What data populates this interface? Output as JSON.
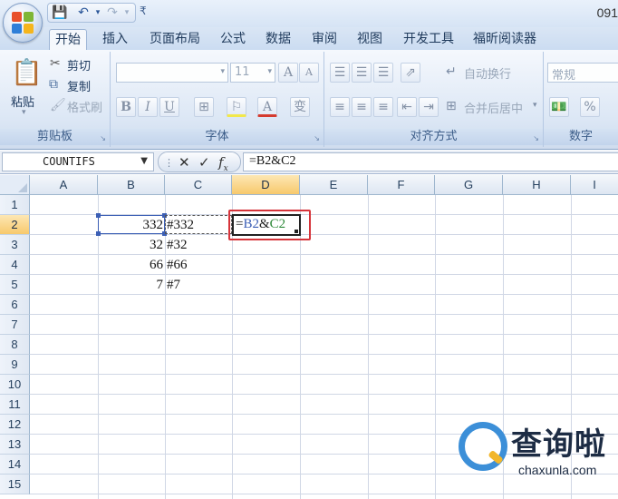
{
  "window": {
    "title_fragment": "091"
  },
  "quick_access": {
    "customize_glyph": "₹"
  },
  "tabs": [
    {
      "label": "开始",
      "active": true
    },
    {
      "label": "插入"
    },
    {
      "label": "页面布局"
    },
    {
      "label": "公式"
    },
    {
      "label": "数据"
    },
    {
      "label": "审阅"
    },
    {
      "label": "视图"
    },
    {
      "label": "开发工具"
    },
    {
      "label": "福昕阅读器"
    }
  ],
  "ribbon": {
    "clipboard": {
      "paste": "粘贴",
      "cut": "剪切",
      "copy": "复制",
      "format_painter": "格式刷",
      "label": "剪贴板"
    },
    "font": {
      "font_name": "",
      "font_size": "11",
      "grow": "A",
      "shrink": "A",
      "bold": "B",
      "italic": "I",
      "underline": "U",
      "font_color": "A",
      "label": "字体"
    },
    "alignment": {
      "wrap_text": "自动换行",
      "merge_center": "合并后居中",
      "label": "对齐方式"
    },
    "number": {
      "format": "常规",
      "percent": "%",
      "label": "数字"
    }
  },
  "formula_bar": {
    "name_box": "COUNTIFS",
    "formula": "=B2&C2"
  },
  "grid": {
    "columns": [
      "A",
      "B",
      "C",
      "D",
      "E",
      "F",
      "G",
      "H",
      "I"
    ],
    "selected_column": "D",
    "rows": [
      "1",
      "2",
      "3",
      "4",
      "5",
      "6",
      "7",
      "8",
      "9",
      "10",
      "11",
      "12",
      "13",
      "14",
      "15"
    ],
    "selected_row": "2",
    "cells": {
      "B2": "332",
      "C2": "#332",
      "B3": "32",
      "C3": "#32",
      "B4": "66",
      "C4": "#66",
      "B5": "7",
      "C5": "#7"
    },
    "editing": {
      "ref_b": "B2",
      "amp": "&",
      "ref_c": "C2",
      "eq": "="
    },
    "ref_colors": {
      "b": "#3c5fb5",
      "c": "#2f8a3a"
    }
  },
  "watermark": {
    "cn": "查询啦",
    "en": "chaxunla.com"
  }
}
